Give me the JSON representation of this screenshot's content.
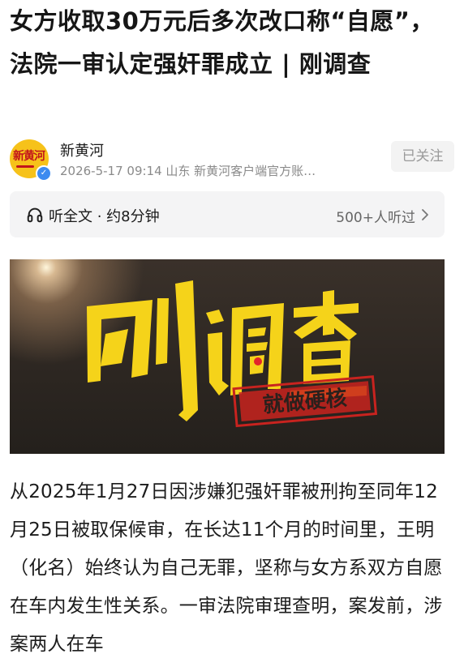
{
  "article": {
    "title": "女方收取30万元后多次改口称“自愿”，法院一审认定强奸罪成立 | 刚调查",
    "author": {
      "name": "新黄河",
      "meta": "2026-5-17 09:14 山东 新黄河客户端官方账…",
      "avatar_icon": "xinhuanghe-logo",
      "verified_icon": "verified-badge-icon",
      "follow_label": "已关注"
    },
    "listen": {
      "icon": "headphone-icon",
      "label": "听全文 · 约8分钟",
      "count": "500+人听过",
      "chevron_icon": "chevron-right-icon"
    },
    "banner": {
      "headline": "刚调查",
      "stamp": "就做硬核"
    },
    "body_text": "从2025年1月27日因涉嫌犯强奸罪被刑拘至同年12月25日被取保候审，在长达11个月的时间里，王明（化名）始终认为自己无罪，坚称与女方系双方自愿在车内发生性关系。一审法院审理查明，案发前，涉案两人在车"
  },
  "colors": {
    "banner_yellow": "#f5d31a",
    "stamp_red": "#c8231f",
    "verified_blue": "#3d8bf0"
  }
}
